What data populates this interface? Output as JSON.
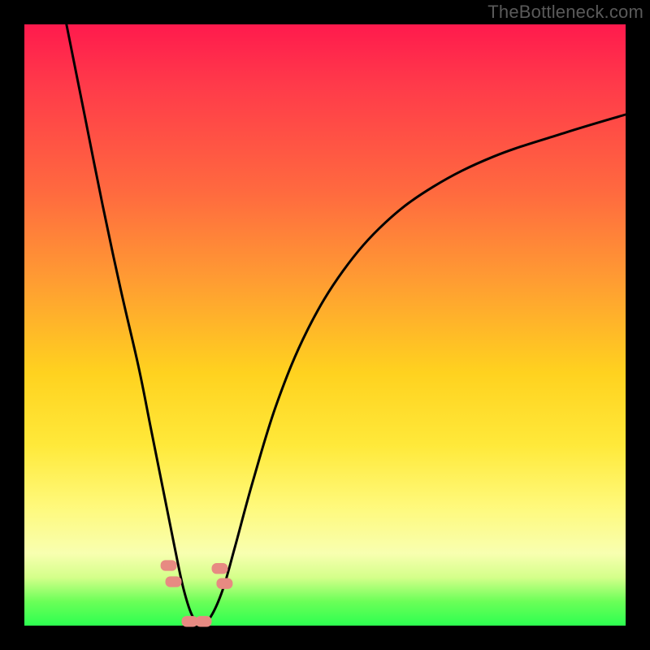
{
  "watermark": "TheBottleneck.com",
  "chart_data": {
    "type": "line",
    "title": "",
    "xlabel": "",
    "ylabel": "",
    "xlim": [
      0,
      100
    ],
    "ylim": [
      0,
      100
    ],
    "background": {
      "gradient_stops": [
        {
          "pos": 0,
          "color": "#ff1a4d"
        },
        {
          "pos": 28,
          "color": "#ff6a3f"
        },
        {
          "pos": 58,
          "color": "#ffd21f"
        },
        {
          "pos": 88,
          "color": "#f8ffb0"
        },
        {
          "pos": 100,
          "color": "#2dff50"
        }
      ]
    },
    "series": [
      {
        "name": "curve",
        "x": [
          7,
          10,
          13,
          16,
          19,
          21,
          23,
          25,
          26.5,
          28,
          29.5,
          31,
          33,
          35,
          38,
          42,
          47,
          53,
          60,
          68,
          78,
          90,
          100
        ],
        "values": [
          100,
          85,
          70,
          56,
          43,
          33,
          23,
          13,
          6,
          1.5,
          0.5,
          1.5,
          6,
          13,
          24,
          37,
          49,
          59,
          67,
          73,
          78,
          82,
          85
        ]
      }
    ],
    "markers": [
      {
        "x": 24.0,
        "y": 10.0
      },
      {
        "x": 24.8,
        "y": 7.3
      },
      {
        "x": 32.5,
        "y": 9.5
      },
      {
        "x": 33.3,
        "y": 7.0
      },
      {
        "x": 27.5,
        "y": 0.7
      },
      {
        "x": 29.8,
        "y": 0.7
      }
    ],
    "marker_style": {
      "shape": "rounded-rect",
      "color": "#e78a82",
      "width": 2.7,
      "height": 1.8
    }
  }
}
